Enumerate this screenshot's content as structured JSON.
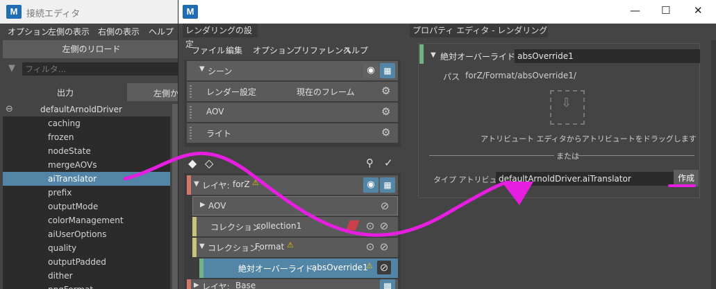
{
  "app_icon": "M",
  "connection_editor": {
    "title": "接続エディタ",
    "menus": [
      "オプション",
      "左側の表示",
      "右側の表示",
      "ヘルプ"
    ],
    "reload_left_label": "左側のリロード",
    "filter_placeholder": "フィルタ...",
    "output_tab": "出力",
    "left_tab": "左側か",
    "node_name": "defaultArnoldDriver",
    "attributes": [
      "caching",
      "frozen",
      "nodeState",
      "mergeAOVs",
      "aiTranslator",
      "prefix",
      "outputMode",
      "colorManagement",
      "aiUserOptions",
      "quality",
      "outputPadded",
      "dither",
      "pngFormat"
    ],
    "selected_attribute": "aiTranslator"
  },
  "render_setup": {
    "window_controls": {
      "minimize": "—",
      "maximize": "☐",
      "close": "✕"
    },
    "left_panel_title": "レンダリングの設定",
    "right_panel_title": "プロパティ エディタ - レンダリング設定",
    "menus": [
      "ファイル",
      "編集",
      "オプション",
      "プリファレンス",
      "ヘルプ"
    ],
    "scene": {
      "header": "シーン",
      "rows": [
        {
          "label": "レンダー設定",
          "value": "現在のフレーム"
        },
        {
          "label": "AOV",
          "value": ""
        },
        {
          "label": "ライト",
          "value": ""
        }
      ]
    },
    "layers": [
      {
        "label": "レイヤ:",
        "name": "forZ",
        "warning": true
      },
      {
        "label": "AOV",
        "name": "",
        "warning": false
      },
      {
        "label": "コレクション:",
        "name": "collection1",
        "warning": false
      },
      {
        "label": "コレクション:",
        "name": "Format",
        "warning": true
      },
      {
        "label": "絶対オーバーライド:",
        "name": "absOverride1",
        "warning": true
      },
      {
        "label": "レイヤ:",
        "name": "Base",
        "warning": false
      }
    ],
    "property_editor": {
      "override_label": "絶対オーバーライド:",
      "override_name": "absOverride1",
      "path_label": "パス",
      "path_value": "forZ/Format/absOverride1/",
      "drag_hint": "アトリビュート エディタからアトリビュートをドラッグします",
      "or_label": "または",
      "type_label": "タイプ アトリビュート",
      "type_value": "defaultArnoldDriver.aiTranslator",
      "create_button": "作成"
    }
  },
  "colors": {
    "selection": "#5285a6",
    "annotation": "#e51edf",
    "layer_stripe": "#d2766e",
    "collection_stripe": "#c8c27a",
    "override_stripe": "#73b184"
  }
}
